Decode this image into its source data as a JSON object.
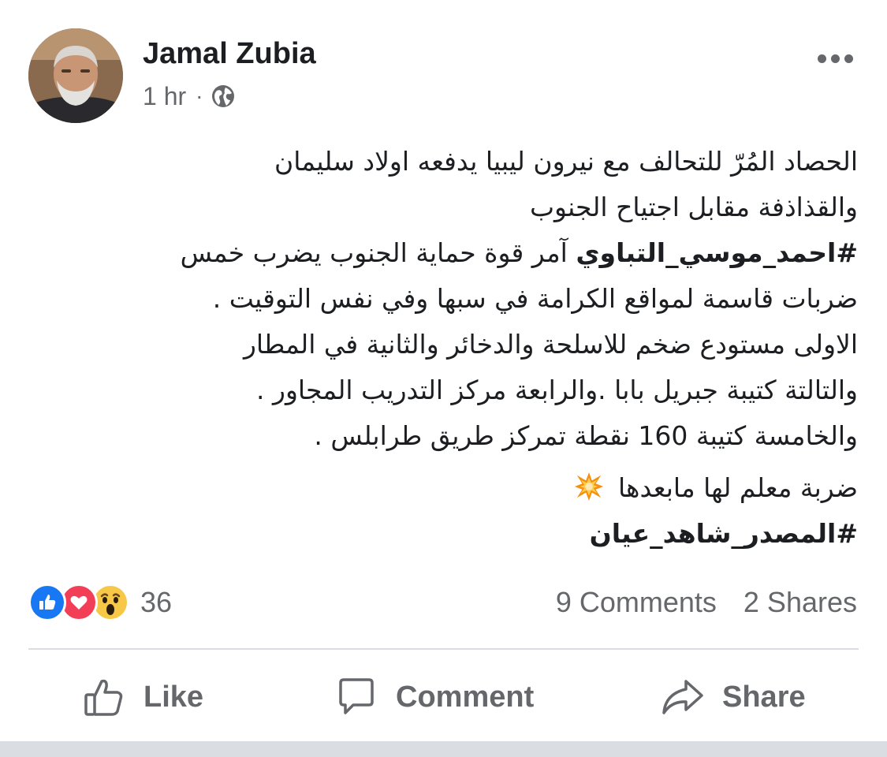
{
  "post": {
    "author": "Jamal Zubia",
    "time": "1 hr",
    "separator": "·",
    "audience_icon": "globe-icon",
    "more_icon": "more-horizontal-icon",
    "lines": [
      "الحصاد المُرّ للتحالف مع نيرون ليبيا يدفعه اولاد سليمان",
      "والقذاذفة مقابل اجتياح الجنوب",
      "آمر قوة حماية الجنوب يضرب خمس",
      "ضربات قاسمة لمواقع  الكرامة في سبها وفي نفس التوقيت .",
      "الاولى مستودع ضخم للاسلحة والدخائر والثانية في المطار",
      "والتالتة كتيبة جبريل بابا .والرابعة مركز التدريب المجاور .",
      "والخامسة كتيبة 160 نقطة تمركز طريق طرابلس .",
      "ضربة معلم لها مابعدها"
    ],
    "hashtag_1": "#احمد_موسي_التباوي",
    "hashtag_2": "#المصدر_شاهد_عيان",
    "emoji_icon": "collision-icon"
  },
  "stats": {
    "reaction_icons": [
      "like-icon",
      "love-icon",
      "wow-icon"
    ],
    "reaction_count": "36",
    "comments": "9 Comments",
    "shares": "2 Shares"
  },
  "actions": {
    "like": "Like",
    "comment": "Comment",
    "share": "Share"
  },
  "colors": {
    "like_blue": "#1877f2",
    "love_red": "#f33e58",
    "wow_yellow": "#f7c847",
    "secondary_text": "#65676b",
    "primary_text": "#1c1e21",
    "divider": "#dadde1"
  }
}
